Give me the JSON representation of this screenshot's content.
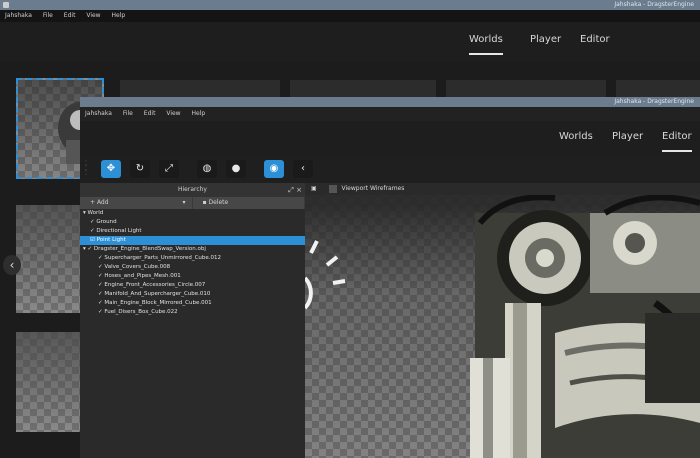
{
  "back_window": {
    "title": "Jahshaka - DragsterEngine",
    "menu": [
      "Jahshaka",
      "File",
      "Edit",
      "View",
      "Help"
    ],
    "tabs": [
      "Worlds",
      "Player",
      "Editor"
    ],
    "active_tab": "Worlds"
  },
  "front_window": {
    "title": "Jahshaka - DragsterEngine",
    "menu": [
      "Jahshaka",
      "File",
      "Edit",
      "View",
      "Help"
    ],
    "tabs": [
      "Worlds",
      "Player",
      "Editor"
    ],
    "active_tab": "Editor"
  },
  "hierarchy": {
    "title": "Hierarchy",
    "add_label": "Add",
    "delete_label": "Delete",
    "items": [
      "World",
      "Ground",
      "Directional Light",
      "Point Light",
      "Dragster_Engine_BlendSwap_Version.obj",
      "Supercharger_Parts_Unmirrored_Cube.012",
      "Valve_Covers_Cube.008",
      "Hoses_and_Pipes_Mesh.001",
      "Engine_Front_Accessories_Circle.007",
      "Manifold_And_Supercharger_Cube.010",
      "Main_Engine_Block_Mirrored_Cube.001",
      "Fuel_Disers_Box_Cube.022"
    ],
    "selected_index": 3
  },
  "viewport": {
    "wireframes_label": "Viewport Wireframes"
  },
  "colors": {
    "accent": "#2d8fd6",
    "titlebar": "#6b7c8f"
  }
}
